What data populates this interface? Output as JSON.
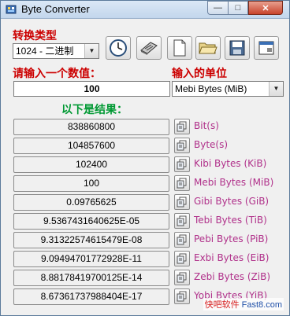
{
  "window": {
    "title": "Byte Converter",
    "minimize": "—",
    "maximize": "□",
    "close": "✕"
  },
  "type_label": "转换类型",
  "type_select": {
    "value": "1024 - 二进制"
  },
  "toolbar": {
    "icons": [
      "clock-icon",
      "calculator-icon",
      "new-file-icon",
      "open-folder-icon",
      "save-icon",
      "window-icon"
    ]
  },
  "input_label": "请输入一个数值：",
  "input_value": "100",
  "unit_label": "输入的单位",
  "unit_select": {
    "value": "Mebi Bytes (MiB)"
  },
  "results_label": "以下是结果：",
  "results": [
    {
      "value": "838860800",
      "unit": "Bit(s)"
    },
    {
      "value": "104857600",
      "unit": "Byte(s)"
    },
    {
      "value": "102400",
      "unit": "Kibi Bytes (KiB)"
    },
    {
      "value": "100",
      "unit": "Mebi Bytes (MiB)"
    },
    {
      "value": "0.09765625",
      "unit": "Gibi Bytes (GiB)"
    },
    {
      "value": "9.5367431640625E-05",
      "unit": "Tebi Bytes (TiB)"
    },
    {
      "value": "9.31322574615479E-08",
      "unit": "Pebi Bytes (PiB)"
    },
    {
      "value": "9.09494701772928E-11",
      "unit": "Exbi Bytes (EiB)"
    },
    {
      "value": "8.88178419700125E-14",
      "unit": "Zebi Bytes (ZiB)"
    },
    {
      "value": "8.67361737988404E-17",
      "unit": "Yobi Bytes (YiB)"
    }
  ],
  "watermark": {
    "part1": "快吧软件",
    "part2": "Fast8.com"
  },
  "colors": {
    "label_red": "#cc0000",
    "label_green": "#009933",
    "unit_text": "#b0308a"
  }
}
